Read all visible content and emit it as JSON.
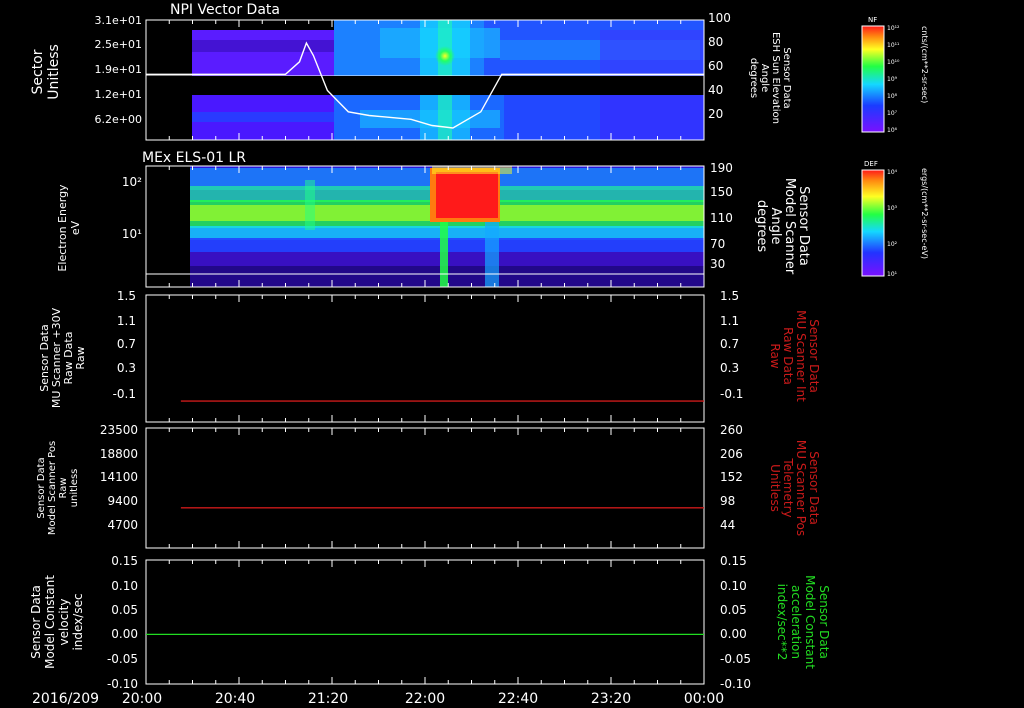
{
  "date_label": "2016/209",
  "colors": {
    "fg": "#ffffff",
    "red": "#cc1a1a",
    "green": "#22dd22"
  },
  "time_axis": {
    "tick_labels": [
      "20:00",
      "20:40",
      "21:20",
      "22:00",
      "22:40",
      "23:20",
      "00:00"
    ]
  },
  "colorbars": [
    {
      "id": "nf",
      "title": "NF",
      "labels": [
        "10¹²",
        "10¹¹",
        "10¹⁰",
        "10⁹",
        "10⁸",
        "10⁷",
        "10⁶"
      ],
      "unit": "cnts/(cm**2-sr-sec)"
    },
    {
      "id": "def",
      "title": "DEF",
      "labels": [
        "10⁴",
        "10³",
        "10²",
        "10¹"
      ],
      "unit": "ergs/(cm**2-sr-sec-eV)"
    }
  ],
  "chart_data": [
    {
      "type": "heatmap",
      "title": "NPI Vector Data",
      "ylabel": [
        "Sector",
        "Unitless"
      ],
      "ytick_labels": [
        "3.1e+01",
        "2.5e+01",
        "1.9e+01",
        "1.2e+01",
        "6.2e+00"
      ],
      "y2label": [
        "Sensor Data",
        "ESH Sun Elevation",
        "Angle",
        "degrees"
      ],
      "y2lim": [
        0,
        100
      ],
      "y2tick_labels": [
        "100",
        "80",
        "60",
        "40",
        "20"
      ],
      "overlay_series": {
        "name": "ESH Sun Elevation Angle",
        "color": "#ffffff",
        "x_hours": [
          20.0,
          20.5,
          21.0,
          21.1,
          21.15,
          21.2,
          21.3,
          21.45,
          21.6,
          21.9,
          22.05,
          22.2,
          22.4,
          22.55,
          22.7,
          23.0,
          23.5,
          24.0
        ],
        "y_deg": [
          55,
          55,
          55,
          65,
          80,
          70,
          42,
          25,
          22,
          19,
          14,
          12,
          25,
          55,
          55,
          55,
          55,
          55
        ]
      }
    },
    {
      "type": "heatmap",
      "title": "MEx ELS-01 LR",
      "ylabel": [
        "Electron Energy",
        "eV"
      ],
      "ytick_labels": [
        "10²",
        "10¹"
      ],
      "y2label": [
        "Sensor Data",
        "Model Scanner",
        "Angle",
        "degrees"
      ],
      "y2lim": [
        10,
        190
      ],
      "y2tick_labels": [
        "190",
        "150",
        "110",
        "70",
        "30"
      ],
      "overlay_series": {
        "name": "Model Scanner Angle",
        "color": "#ffffff",
        "x_hours": [
          20.0,
          24.0
        ],
        "y_deg": [
          12,
          12
        ]
      }
    },
    {
      "type": "line",
      "ylabel": [
        "Sensor Data",
        "MU Scanner +30V",
        "Raw Data",
        "Raw"
      ],
      "ylim": [
        -0.3,
        1.5
      ],
      "ytick_labels": [
        "1.5",
        "1.1",
        "0.7",
        "0.3",
        "-0.1"
      ],
      "y2label": [
        "Sensor Data",
        "MU Scanner Int",
        "Raw Data",
        "Raw"
      ],
      "y2tick_labels": [
        "1.5",
        "1.1",
        "0.7",
        "0.3",
        "-0.1"
      ],
      "series": [
        {
          "color": "#cc1a1a",
          "x_hours": [
            20.25,
            24.0
          ],
          "values": [
            -0.05,
            -0.05
          ]
        }
      ]
    },
    {
      "type": "line",
      "ylabel": [
        "Sensor Data",
        "Model Scanner Pos",
        "Raw",
        "unitless"
      ],
      "ylim": [
        0,
        23500
      ],
      "ytick_labels": [
        "23500",
        "18800",
        "14100",
        "9400",
        "4700"
      ],
      "y2label": [
        "Sensor Data",
        "MU Scanner Pos",
        "Telemetry",
        "Unitless"
      ],
      "y2tick_labels": [
        "260",
        "206",
        "152",
        "98",
        "44"
      ],
      "series": [
        {
          "color": "#cc1a1a",
          "x_hours": [
            20.25,
            24.0
          ],
          "values": [
            8000,
            8000
          ]
        }
      ]
    },
    {
      "type": "line",
      "ylabel": [
        "Sensor Data",
        "Model Constant",
        "velocity",
        "index/sec"
      ],
      "ylim": [
        -0.1,
        0.15
      ],
      "ytick_labels": [
        "0.15",
        "0.10",
        "0.05",
        "0.00",
        "-0.05",
        "-0.10"
      ],
      "y2label": [
        "Sensor Data",
        "Model Constant",
        "acceleration",
        "index/sec**2"
      ],
      "y2tick_labels": [
        "0.15",
        "0.10",
        "0.05",
        "0.00",
        "-0.05",
        "-0.10"
      ],
      "series": [
        {
          "color": "#22dd22",
          "x_hours": [
            20.0,
            24.0
          ],
          "values": [
            0.0,
            0.0
          ]
        }
      ]
    }
  ]
}
